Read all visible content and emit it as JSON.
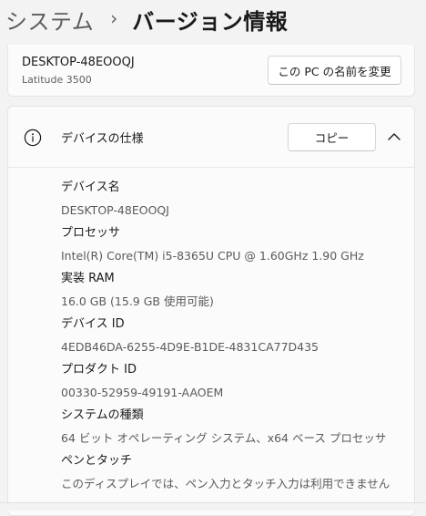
{
  "header": {
    "parent": "システム",
    "separator": "›",
    "current": "バージョン情報"
  },
  "pc_card": {
    "device_name": "DESKTOP-48EOOQJ",
    "model": "Latitude 3500",
    "rename_button": "この PC の名前を変更"
  },
  "spec_card": {
    "icon": "info-icon",
    "title": "デバイスの仕様",
    "copy_button": "コピー",
    "collapse_icon": "chevron-up-icon",
    "items": [
      {
        "label": "デバイス名",
        "value": "DESKTOP-48EOOQJ"
      },
      {
        "label": "プロセッサ",
        "value": "Intel(R) Core(TM) i5-8365U CPU @ 1.60GHz   1.90 GHz"
      },
      {
        "label": "実装 RAM",
        "value": "16.0 GB (15.9 GB 使用可能)"
      },
      {
        "label": "デバイス ID",
        "value": "4EDB46DA-6255-4D9E-B1DE-4831CA77D435"
      },
      {
        "label": "プロダクト ID",
        "value": "00330-52959-49191-AAOEM"
      },
      {
        "label": "システムの種類",
        "value": "64 ビット オペレーティング システム、x64 ベース プロセッサ"
      },
      {
        "label": "ペンとタッチ",
        "value": "このディスプレイでは、ペン入力とタッチ入力は利用できません"
      }
    ]
  }
}
